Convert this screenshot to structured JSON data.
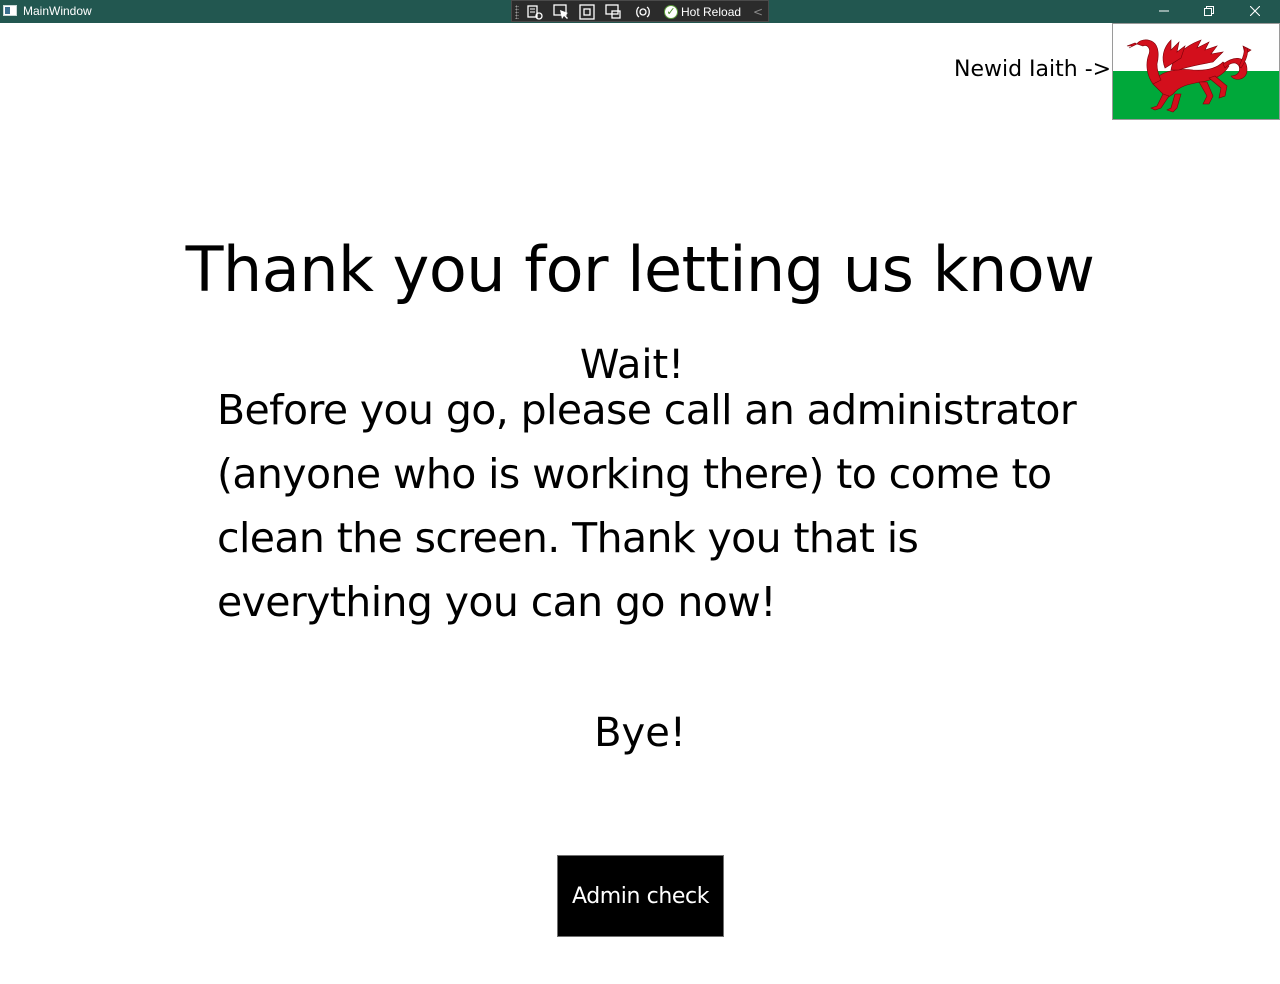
{
  "window": {
    "title": "MainWindow",
    "titlebar_color": "#225750",
    "icon": "app-window-icon",
    "controls": [
      "minimize-icon",
      "restore-icon",
      "close-icon"
    ]
  },
  "dev_toolbar": {
    "tools": [
      "go-to-live-visual-tree-icon",
      "select-element-icon",
      "display-layout-adorners-icon",
      "track-focused-element-icon",
      "binding-failures-icon"
    ],
    "hot_reload_label": "Hot Reload",
    "hot_reload_status_icon": "check-circle-icon",
    "collapse_icon": "chevron-left-icon"
  },
  "language": {
    "label": "Newid Iaith ->",
    "flag_icon": "welsh-flag-icon",
    "flag_colors": {
      "white": "#ffffff",
      "green": "#00a83a",
      "dragon": "#d30f1c"
    }
  },
  "content": {
    "title": "Thank you for letting us know",
    "wait": "Wait!",
    "instructions": "Before you go, please call an administrator (anyone who is working there) to come to clean the screen. Thank you that is everything you can go now!",
    "bye": "Bye!"
  },
  "admin_button": {
    "label": "Admin check",
    "background": "#000000",
    "text_color": "#ffffff"
  }
}
